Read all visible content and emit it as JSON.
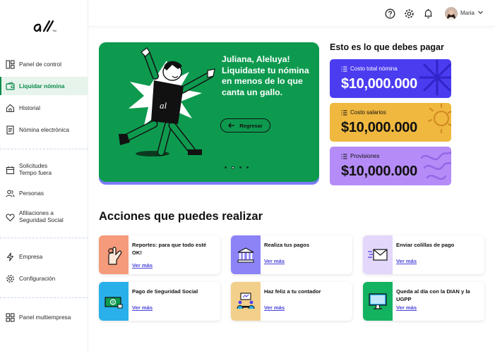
{
  "brand": {
    "logo_text": "al",
    "logo_mark": "TM"
  },
  "sidebar": {
    "items": [
      {
        "label": "Panel de control",
        "icon": "dashboard-icon"
      },
      {
        "label": "Liquidar nómina",
        "icon": "wallet-icon",
        "active": true
      },
      {
        "label": "Historial",
        "icon": "home-icon"
      },
      {
        "label": "Nómina electrónica",
        "icon": "document-icon"
      },
      {
        "label": "Solicitudes",
        "label2": "Tempo fuera",
        "icon": "calendar-icon"
      },
      {
        "label": "Personas",
        "icon": "people-icon"
      },
      {
        "label": "Afiliaciones a",
        "label2": "Seguridad Social",
        "icon": "heart-icon"
      },
      {
        "label": "Empresa",
        "icon": "bolt-icon"
      },
      {
        "label": "Configuración",
        "icon": "gear-icon"
      },
      {
        "label": "Panel multiempresa",
        "icon": "grid-icon"
      }
    ]
  },
  "topbar": {
    "user_name": "Maria",
    "icons": [
      "help-icon",
      "settings-icon",
      "bell-icon"
    ]
  },
  "hero": {
    "message": "Juliana, Aleluya! Liquidaste tu nómina en menos de lo que canta un gallo.",
    "button_label": "Regresar",
    "dots": 4,
    "active_dot": 1
  },
  "pay": {
    "title": "Esto es lo que debes pagar",
    "cards": [
      {
        "label": "Costo total nómina",
        "amount": "$10,000.000",
        "color": "#4b3cf0"
      },
      {
        "label": "Costo salarios",
        "amount": "$10,000.000",
        "color": "#f0b83f"
      },
      {
        "label": "Provisiones",
        "amount": "$10,000.000",
        "color": "#b58cf7"
      }
    ]
  },
  "actions": {
    "title": "Acciones que puedes realizar",
    "link_label": "Ver más",
    "items": [
      {
        "title": "Reportes: para que todo esté OK!",
        "color": "#f59a7a",
        "icon": "ok-hand-icon"
      },
      {
        "title": "Realiza tus pagos",
        "color": "#8c83f7",
        "icon": "bank-icon"
      },
      {
        "title": "Enviar colillas de pago",
        "color": "#e3d7fb",
        "icon": "envelope-icon"
      },
      {
        "title": "Pago de Seguridad Social",
        "color": "#29b0ea",
        "icon": "money-icon"
      },
      {
        "title": "Haz feliz a tu contador",
        "color": "#f2cf8b",
        "icon": "meeting-icon"
      },
      {
        "title": "Queda al día con la DIAN y la UGPP",
        "color": "#14b361",
        "icon": "monitor-icon"
      }
    ]
  }
}
